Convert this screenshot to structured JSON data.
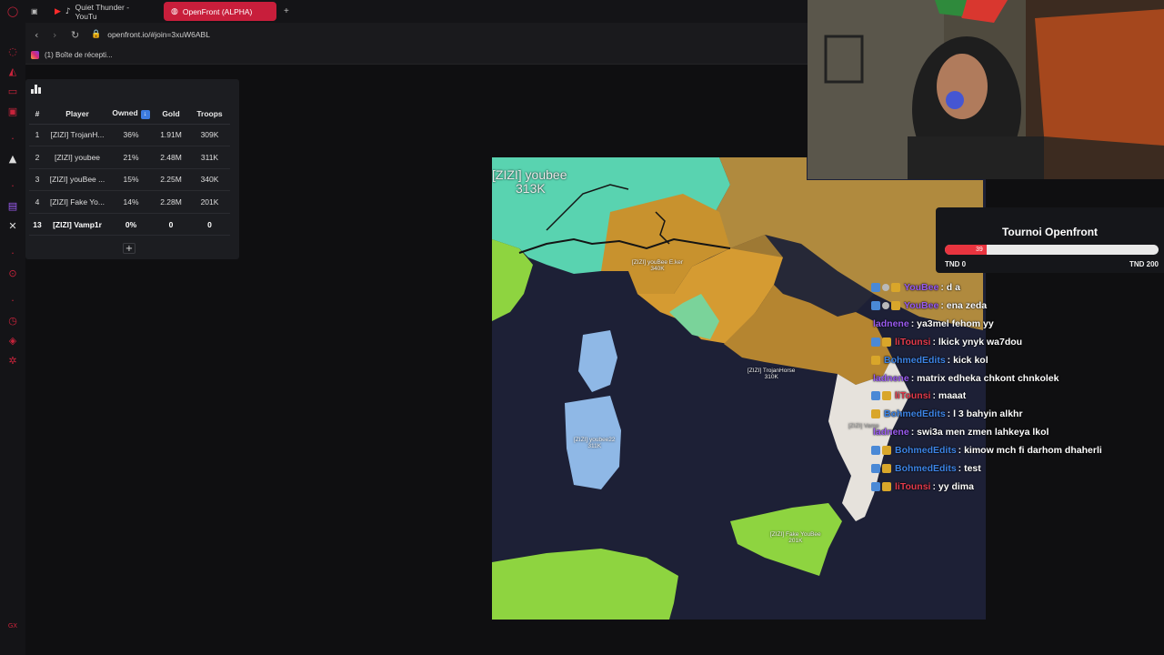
{
  "tabs": [
    {
      "icon": "youtube-icon",
      "sound_icon": "speaker-icon",
      "label": "Quiet Thunder - YouTu",
      "active": false
    },
    {
      "icon": "globe-icon",
      "label": "OpenFront (ALPHA)",
      "active": true
    }
  ],
  "new_tab_label": "+",
  "address": {
    "url": "openfront.io/#join=3xuW6ABL"
  },
  "bookmarks": [
    {
      "icon": "instagram-icon",
      "label": "(1) Boîte de récepti..."
    }
  ],
  "leaderboard": {
    "headers": [
      "#",
      "Player",
      "Owned",
      "Gold",
      "Troops"
    ],
    "sort_badge": "↓",
    "rows": [
      {
        "rank": "1",
        "player": "[ZIZI] TrojanH...",
        "owned": "36%",
        "gold": "1.91M",
        "troops": "309K"
      },
      {
        "rank": "2",
        "player": "[ZIZI] youbee",
        "owned": "21%",
        "gold": "2.48M",
        "troops": "311K"
      },
      {
        "rank": "3",
        "player": "[ZIZI] youBee ...",
        "owned": "15%",
        "gold": "2.25M",
        "troops": "340K"
      },
      {
        "rank": "4",
        "player": "[ZIZI] Fake Yo...",
        "owned": "14%",
        "gold": "2.28M",
        "troops": "201K"
      },
      {
        "rank": "13",
        "player": "[ZIZI] Vamp1r",
        "owned": "0%",
        "gold": "0",
        "troops": "0"
      }
    ],
    "expand_label": "+"
  },
  "map": {
    "labels": [
      {
        "name": "[ZIZI] youbee",
        "troops": "313K"
      },
      {
        "name": "[ZIZI] youBee E.ker",
        "troops": "340K"
      },
      {
        "name": "[ZIZI] TrojanHorse",
        "troops": "310K"
      },
      {
        "name": "[ZIZI] youbee22",
        "troops": "311K"
      },
      {
        "name": "[ZIZI] Fake YouBee",
        "troops": "201K"
      },
      {
        "name": "[ZIZI] Vamp",
        "troops": ""
      }
    ],
    "colors": {
      "sea": "#1d2036",
      "teal": "#59d3b0",
      "green": "#8ed440",
      "orange": "#c8922e",
      "olive": "#b08a3e",
      "blue": "#8fb8e6",
      "white": "#e6e2dc"
    }
  },
  "donation": {
    "title": "Tournoi Openfront",
    "current": 39,
    "min_label": "TND 0",
    "max_label": "TND 200",
    "goal": 200
  },
  "chat": [
    {
      "badges": [
        "tw",
        "mod",
        "crown"
      ],
      "user": "YouBee",
      "color": "#9b5cf2",
      "text": ": d a"
    },
    {
      "badges": [
        "tw",
        "mod",
        "crown"
      ],
      "user": "YouBee",
      "color": "#9b5cf2",
      "text": ": ena zeda"
    },
    {
      "badges": [],
      "user": "ladnene",
      "color": "#9b5cf2",
      "text": ": ya3mel fehom yy"
    },
    {
      "badges": [
        "tw",
        "crown"
      ],
      "user": "liTounsi",
      "color": "#e23b4c",
      "text": ": lkick ynyk wa7dou"
    },
    {
      "badges": [
        "crown"
      ],
      "user": "BohmedEdits",
      "color": "#3d84e6",
      "text": ": kick kol"
    },
    {
      "badges": [],
      "user": "ladnene",
      "color": "#9b5cf2",
      "text": ": matrix edheka chkont chnkolek"
    },
    {
      "badges": [
        "tw",
        "crown"
      ],
      "user": "liTounsi",
      "color": "#e23b4c",
      "text": ": maaat"
    },
    {
      "badges": [
        "crown"
      ],
      "user": "BohmedEdits",
      "color": "#3d84e6",
      "text": ": l 3 bahyin alkhr"
    },
    {
      "badges": [],
      "user": "ladnene",
      "color": "#9b5cf2",
      "text": ": swi3a men zmen lahkeya lkol"
    },
    {
      "badges": [
        "tw",
        "crown"
      ],
      "user": "BohmedEdits",
      "color": "#3d84e6",
      "text": ": kimow mch fi darhom dhaherli"
    },
    {
      "badges": [
        "tw",
        "crown"
      ],
      "user": "BohmedEdits",
      "color": "#3d84e6",
      "text": ": test"
    },
    {
      "badges": [
        "tw",
        "crown"
      ],
      "user": "liTounsi",
      "color": "#e23b4c",
      "text": ": yy dima"
    }
  ]
}
